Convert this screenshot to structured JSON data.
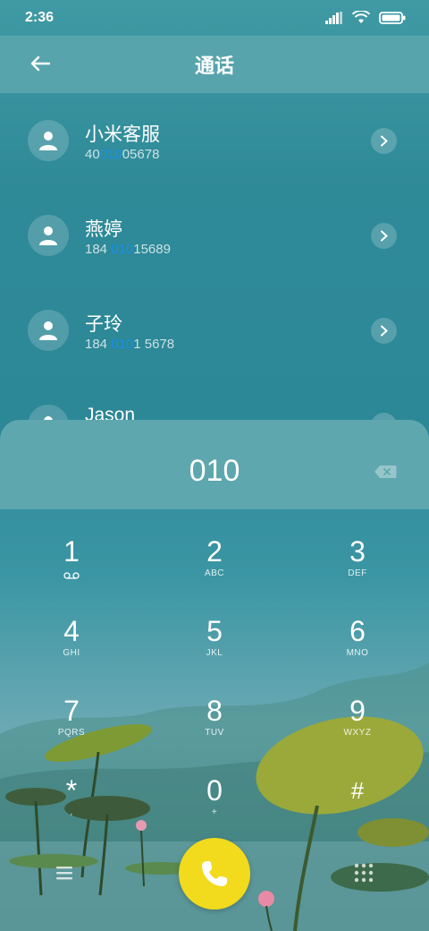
{
  "status": {
    "time": "2:36"
  },
  "header": {
    "title": "通话"
  },
  "contacts": [
    {
      "name": "小米客服",
      "num_pre": "40",
      "num_hl": "010",
      "num_post": "05678"
    },
    {
      "name": "燕婷",
      "num_pre": "184 ",
      "num_hl": "010",
      "num_post": "15689"
    },
    {
      "name": "子玲",
      "num_pre": "184 ",
      "num_hl": "010",
      "num_post": "1 5678"
    },
    {
      "name": "Jason"
    }
  ],
  "dialer": {
    "input": "010",
    "keys": [
      {
        "num": "1",
        "sub": ""
      },
      {
        "num": "2",
        "sub": "ABC"
      },
      {
        "num": "3",
        "sub": "DEF"
      },
      {
        "num": "4",
        "sub": "GHI"
      },
      {
        "num": "5",
        "sub": "JKL"
      },
      {
        "num": "6",
        "sub": "MNO"
      },
      {
        "num": "7",
        "sub": "PQRS"
      },
      {
        "num": "8",
        "sub": "TUV"
      },
      {
        "num": "9",
        "sub": "WXYZ"
      },
      {
        "num": "*",
        "sub": ","
      },
      {
        "num": "0",
        "sub": "+"
      },
      {
        "num": "#",
        "sub": ""
      }
    ]
  },
  "colors": {
    "call_button": "#f2da1c",
    "highlight": "#1a8fe8",
    "header": "#58a4ac"
  },
  "icons": [
    "back-arrow-icon",
    "signal-icon",
    "wifi-icon",
    "battery-icon",
    "person-icon",
    "chevron-right-icon",
    "backspace-icon",
    "voicemail-icon",
    "phone-icon",
    "menu-icon",
    "dialpad-icon"
  ]
}
